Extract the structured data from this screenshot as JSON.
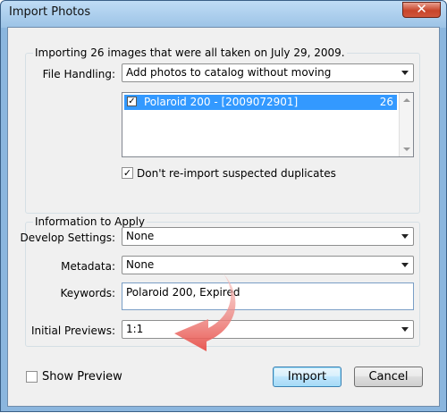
{
  "window": {
    "title": "Import Photos"
  },
  "group1": {
    "caption": "Importing 26 images that were all taken on July 29, 2009.",
    "file_handling_label": "File Handling:",
    "file_handling_value": "Add photos to catalog without moving",
    "list_items": [
      {
        "name": "Polaroid 200 - [2009072901]",
        "count": "26",
        "checked": true
      }
    ],
    "dont_reimport_label": "Don't re-import suspected duplicates",
    "dont_reimport_checked": true
  },
  "group2": {
    "caption": "Information to Apply",
    "develop_label": "Develop Settings:",
    "develop_value": "None",
    "metadata_label": "Metadata:",
    "metadata_value": "None",
    "keywords_label": "Keywords:",
    "keywords_value": "Polaroid 200, Expired",
    "previews_label": "Initial Previews:",
    "previews_value": "1:1"
  },
  "footer": {
    "show_preview_label": "Show Preview",
    "show_preview_checked": false,
    "import_label": "Import",
    "cancel_label": "Cancel"
  },
  "annotation": {
    "arrow_color": "#e8504a"
  }
}
